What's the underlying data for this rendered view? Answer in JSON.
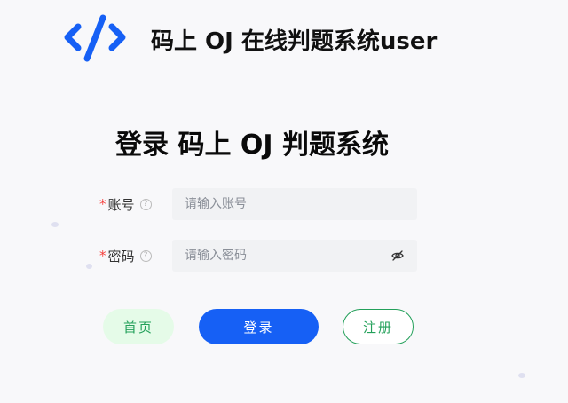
{
  "app": {
    "title": "码上 OJ 在线判题系统user"
  },
  "login": {
    "title": "登录 码上 OJ 判题系统",
    "account": {
      "required_mark": "*",
      "label": "账号",
      "help_icon": "question-circle-icon",
      "placeholder": "请输入账号",
      "value": ""
    },
    "password": {
      "required_mark": "*",
      "label": "密码",
      "help_icon": "question-circle-icon",
      "placeholder": "请输入密码",
      "value": "",
      "toggle_icon": "eye-off-icon"
    }
  },
  "buttons": {
    "home": "首页",
    "login": "登录",
    "register": "注册"
  },
  "colors": {
    "primary": "#1660f5",
    "success": "#23a05a",
    "success_bg": "#e5fbe8",
    "required": "#f5403d",
    "input_bg": "#f1f2f4",
    "page_bg": "#f8f8fa"
  }
}
